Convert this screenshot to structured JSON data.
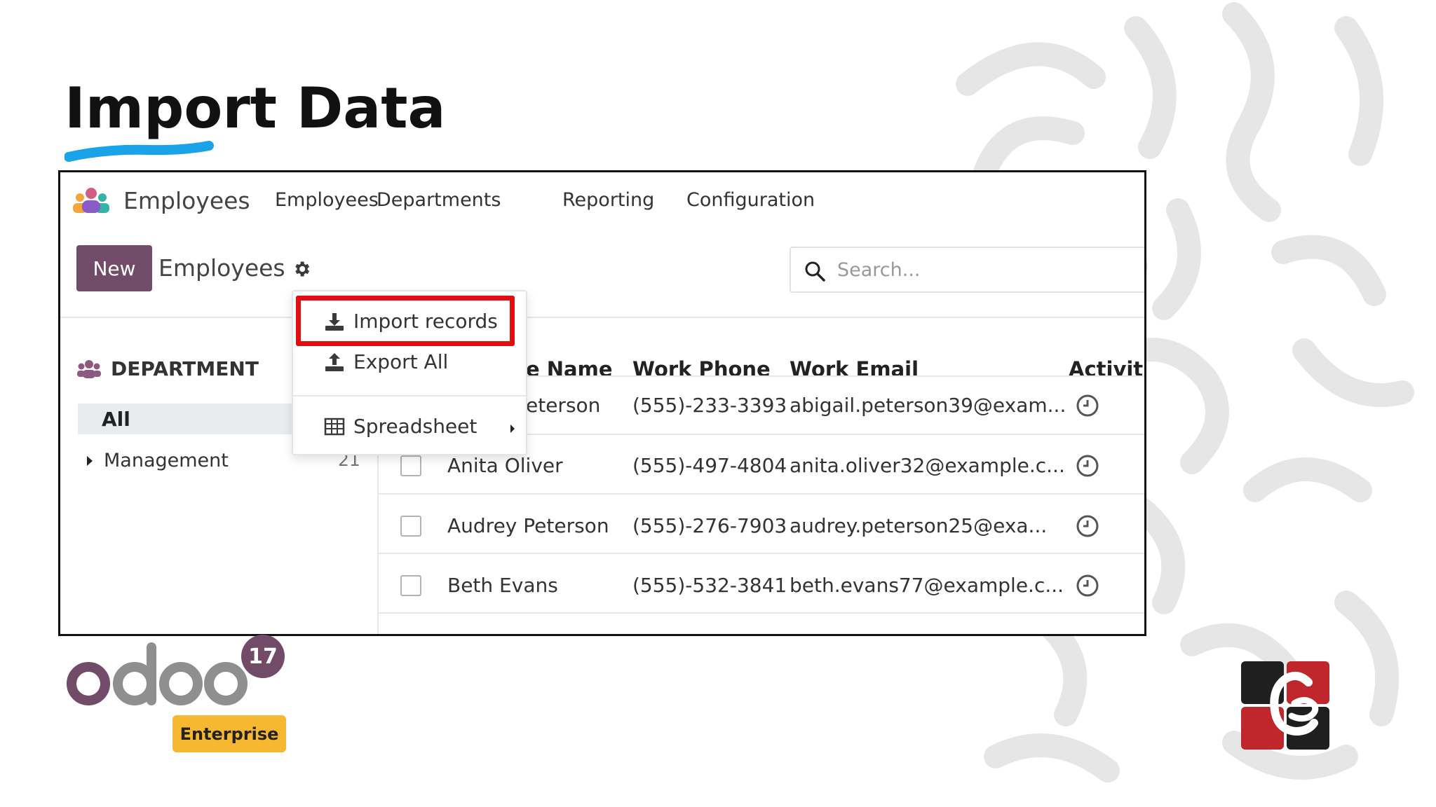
{
  "slide": {
    "title": "Import Data"
  },
  "app": {
    "name": "Employees",
    "nav": [
      "Employees",
      "Departments",
      "Reporting",
      "Configuration"
    ]
  },
  "control": {
    "new_label": "New",
    "breadcrumb": "Employees",
    "search_placeholder": "Search..."
  },
  "dropdown": {
    "import_label": "Import records",
    "export_label": "Export All",
    "spreadsheet_label": "Spreadsheet"
  },
  "sidebar": {
    "heading": "DEPARTMENT",
    "all_label": "All",
    "management_label": "Management",
    "management_count": "21"
  },
  "table": {
    "headers": [
      "e Name",
      "Work Phone",
      "Work Email",
      "Activitie"
    ],
    "rows": [
      {
        "name": "eterson",
        "phone": "(555)-233-3393",
        "email": "abigail.peterson39@exam..."
      },
      {
        "name": "Anita Oliver",
        "phone": "(555)-497-4804",
        "email": "anita.oliver32@example.c..."
      },
      {
        "name": "Audrey Peterson",
        "phone": "(555)-276-7903",
        "email": "audrey.peterson25@exa..."
      },
      {
        "name": "Beth Evans",
        "phone": "(555)-532-3841",
        "email": "beth.evans77@example.c..."
      }
    ]
  },
  "branding": {
    "odoo_version": "17",
    "edition": "Enterprise",
    "colors": {
      "odoo_purple": "#714B67",
      "odoo_gray": "#8F8F8F",
      "enterprise_yellow": "#F7B731",
      "highlight_red": "#E01010",
      "underline_blue": "#1AA3E8",
      "logo_red": "#C0272D"
    }
  }
}
